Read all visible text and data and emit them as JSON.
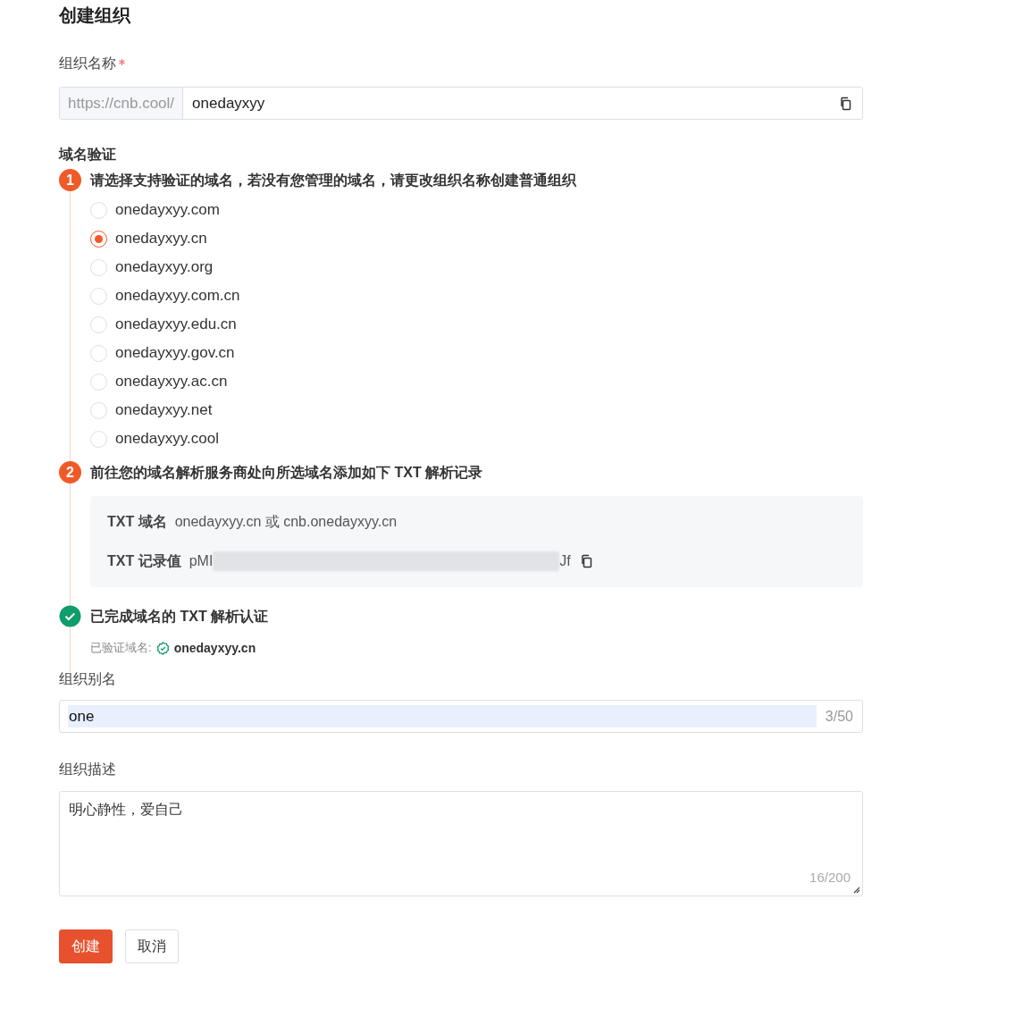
{
  "title": "创建组织",
  "org_name": {
    "label": "组织名称",
    "required": true,
    "prefix": "https://cnb.cool/",
    "value": "onedayxyy"
  },
  "domain_verification": {
    "label": "域名验证",
    "steps": [
      {
        "kind": "number",
        "marker": "1",
        "title": "请选择支持验证的域名，若没有您管理的域名，请更改组织名称创建普通组织",
        "options": [
          {
            "label": "onedayxyy.com",
            "selected": false
          },
          {
            "label": "onedayxyy.cn",
            "selected": true
          },
          {
            "label": "onedayxyy.org",
            "selected": false
          },
          {
            "label": "onedayxyy.com.cn",
            "selected": false
          },
          {
            "label": "onedayxyy.edu.cn",
            "selected": false
          },
          {
            "label": "onedayxyy.gov.cn",
            "selected": false
          },
          {
            "label": "onedayxyy.ac.cn",
            "selected": false
          },
          {
            "label": "onedayxyy.net",
            "selected": false
          },
          {
            "label": "onedayxyy.cool",
            "selected": false
          }
        ]
      },
      {
        "kind": "number",
        "marker": "2",
        "title": "前往您的域名解析服务商处向所选域名添加如下 TXT 解析记录",
        "record": {
          "domain_label": "TXT 域名",
          "domain_value": "onedayxyy.cn 或 cnb.onedayxyy.cn",
          "value_label": "TXT 记录值",
          "value_start": "pMI",
          "value_end": "Jf"
        }
      },
      {
        "kind": "done",
        "title": "已完成域名的 TXT 解析认证",
        "verified_label": "已验证域名:",
        "verified_domain": "onedayxyy.cn"
      }
    ]
  },
  "alias": {
    "label": "组织别名",
    "value": "one",
    "text_selected": true,
    "count": "3/50"
  },
  "description": {
    "label": "组织描述",
    "value": "明心静性，爱自己",
    "count": "16/200"
  },
  "buttons": [
    {
      "kind": "primary",
      "label": "创建"
    },
    {
      "kind": "secondary",
      "label": "取消"
    }
  ]
}
